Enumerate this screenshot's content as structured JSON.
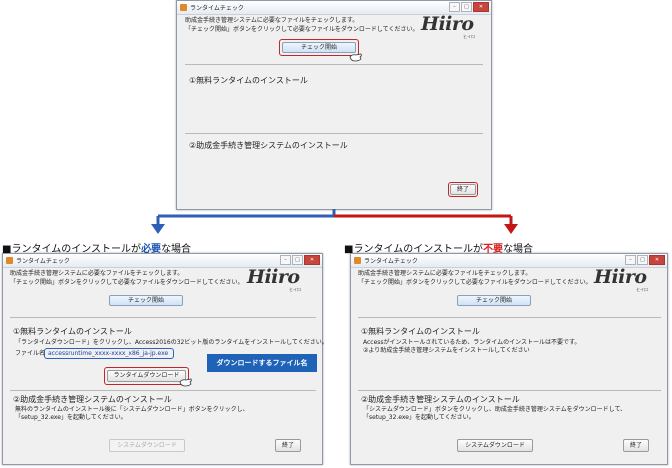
{
  "windows": {
    "top": {
      "title": "ランタイムチェック",
      "intro_line1": "助成金手続き管理システムに必要なファイルをチェックします。",
      "intro_line2": "「チェック開始」ボタンをクリックして必要なファイルをダウンロードしてください。",
      "logo": "Hiiro",
      "logo_sub": "ヒイロ",
      "check_button": "チェック開始",
      "section1": "①無料ランタイムのインストール",
      "section2": "②助成金手続き管理システムのインストール",
      "exit_button": "終了"
    },
    "left": {
      "title": "ランタイムチェック",
      "intro_line1": "助成金手続き管理システムに必要なファイルをチェックします。",
      "intro_line2": "「チェック開始」ボタンをクリックして必要なファイルをダウンロードしてください。",
      "logo": "Hiiro",
      "logo_sub": "ヒイロ",
      "check_button": "チェック開始",
      "section1": "①無料ランタイムのインストール",
      "section1_text": "「ランタイムダウンロード」をクリックし、Access2016の32ビット版のランタイムをインストールしてください。",
      "filename_label": "ファイル名",
      "filename_value": "accessruntime_xxxx-xxxx_x86_ja-jp.exe",
      "callout": "ダウンロードするファイル名",
      "runtime_button": "ランタイムダウンロード",
      "section2": "②助成金手続き管理システムのインストール",
      "section2_text1": "無料のランタイムのインストール後に「システムダウンロード」ボタンをクリックし、",
      "section2_text2": "「setup_32.exe」を起動してください。",
      "system_button": "システムダウンロード",
      "exit_button": "終了"
    },
    "right": {
      "title": "ランタイムチェック",
      "intro_line1": "助成金手続き管理システムに必要なファイルをチェックします。",
      "intro_line2": "「チェック開始」ボタンをクリックして必要なファイルをダウンロードしてください。",
      "logo": "Hiiro",
      "logo_sub": "ヒイロ",
      "check_button": "チェック開始",
      "section1": "①無料ランタイムのインストール",
      "section1_text1": "Accessがインストールされているため、ランタイムのインストールは不要です。",
      "section1_text2": "②より助成金手続き管理システムをインストールしてください",
      "section2": "②助成金手続き管理システムのインストール",
      "section2_text1": "「システムダウンロード」ボタンをクリックし、助成金手続き管理システムをダウンロードして、",
      "section2_text2": "「setup_32.exe」を起動してください。",
      "system_button": "システムダウンロード",
      "exit_button": "終了"
    }
  },
  "captions": {
    "left_pre": "■ランタイムのインストールが",
    "left_em": "必要",
    "left_post": "な場合",
    "right_pre": "■ランタイムのインストールが",
    "right_em": "不要",
    "right_post": "な場合"
  },
  "colors": {
    "arrow_left": "#2f5fb4",
    "arrow_right": "#c41616",
    "highlight": "#c0262a",
    "callout": "#1f63b8"
  }
}
